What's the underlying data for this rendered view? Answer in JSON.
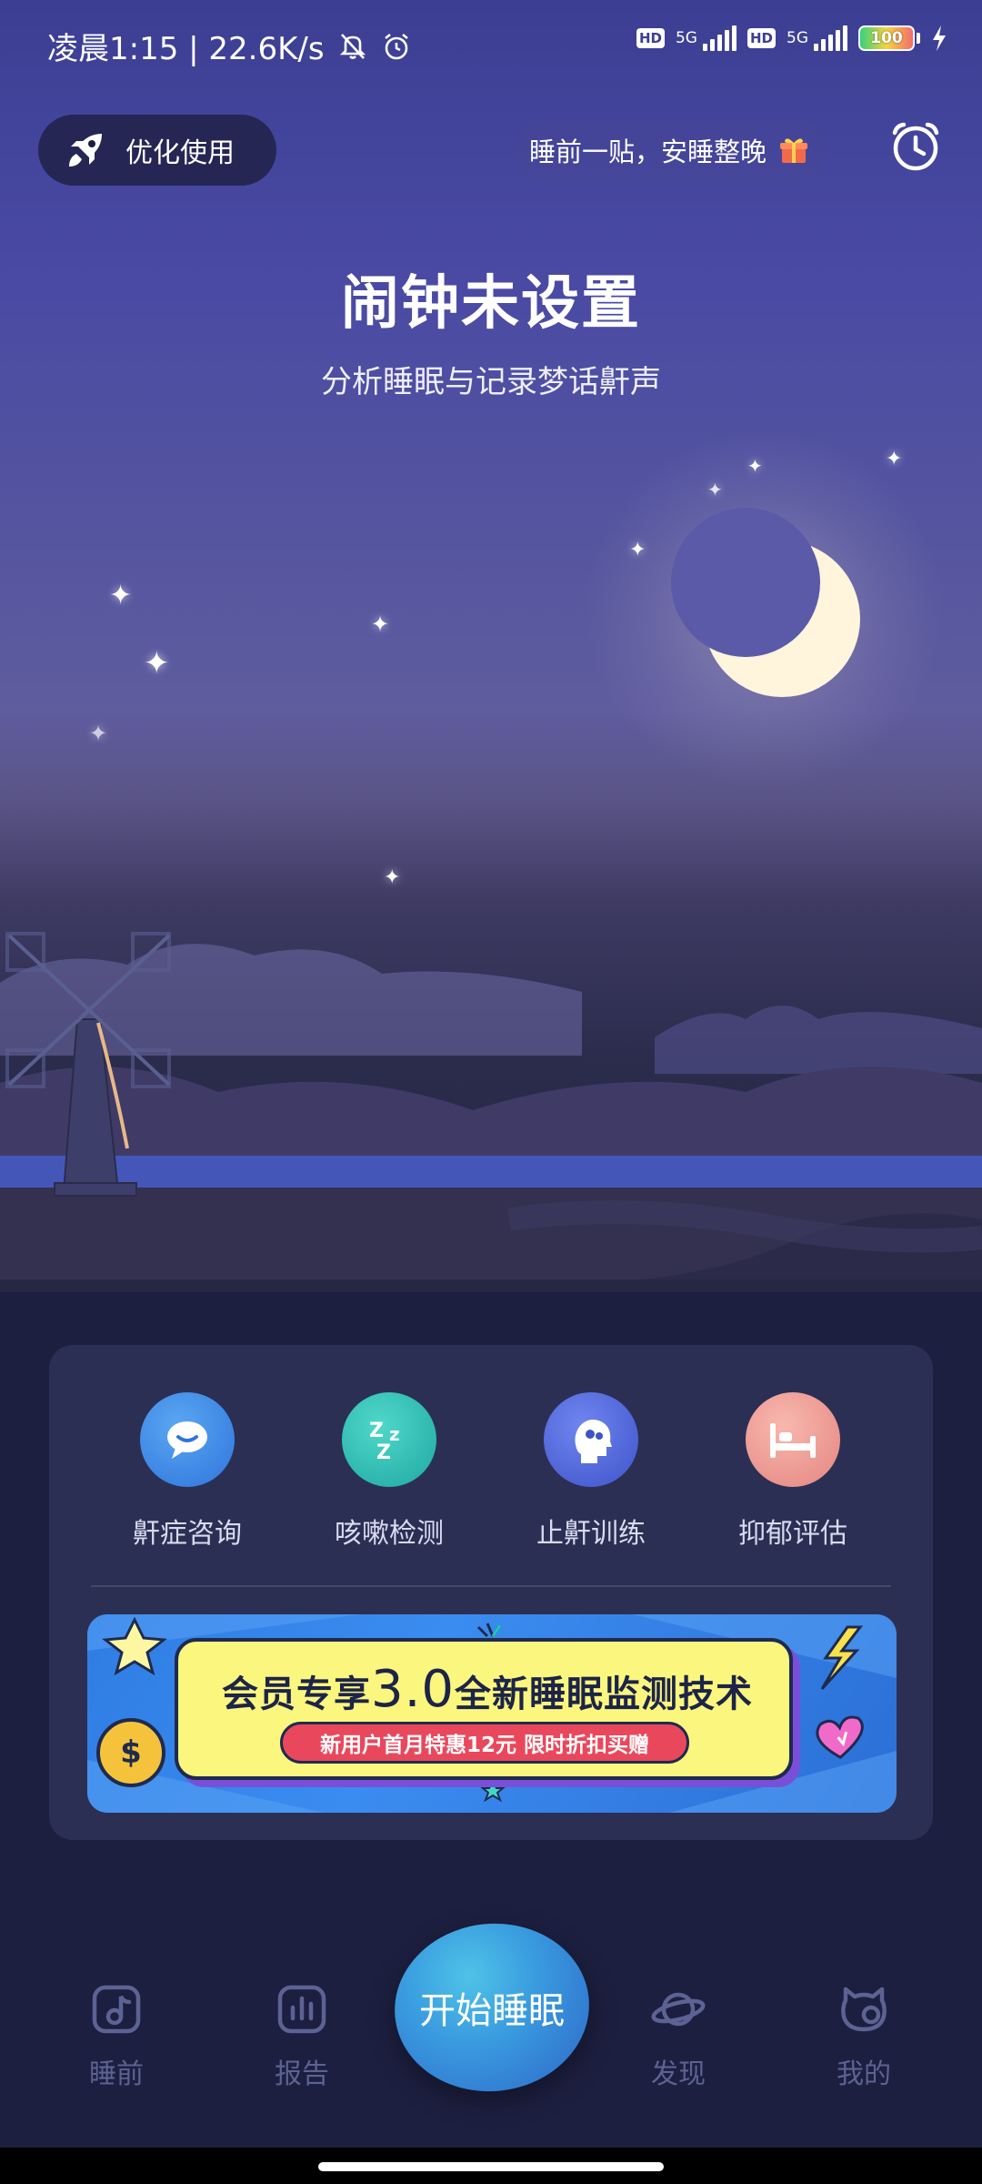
{
  "status_bar": {
    "time_and_speed": "凌晨1:15 | 22.6K/s",
    "hd_label": "HD",
    "network_label": "5G",
    "battery_level": "100",
    "battery_percent": 100,
    "icons": [
      "mute-icon",
      "alarm-status-icon",
      "hd-badge",
      "signal-icon",
      "battery-icon",
      "charging-icon"
    ]
  },
  "header": {
    "optimize_label": "优化使用",
    "promo_label": "睡前一贴，安睡整晚",
    "icons": [
      "rocket-icon",
      "gift-icon",
      "alarm-clock-icon"
    ]
  },
  "hero": {
    "title": "闹钟未设置",
    "subtitle": "分析睡眠与记录梦话鼾声"
  },
  "features": [
    {
      "label": "鼾症咨询",
      "icon": "chat-icon",
      "color": "#3c86e8"
    },
    {
      "label": "咳嗽检测",
      "icon": "zzz-icon",
      "color": "#2fc1b5"
    },
    {
      "label": "止鼾训练",
      "icon": "brain-head-icon",
      "color": "#4a67d9"
    },
    {
      "label": "抑郁评估",
      "icon": "bed-icon",
      "color": "#ee9f9c"
    }
  ],
  "banner": {
    "headline_pre": "会员专享",
    "headline_version": "3.0",
    "headline_post": "全新睡眠监测技术",
    "pill_text": "新用户首月特惠12元   限时折扣买赠",
    "coin_symbol": "$"
  },
  "bottom_nav": {
    "items": [
      {
        "label": "睡前",
        "icon": "music-note-icon"
      },
      {
        "label": "报告",
        "icon": "bar-chart-icon"
      },
      {
        "label": "发现",
        "icon": "planet-icon"
      },
      {
        "label": "我的",
        "icon": "profile-icon"
      }
    ],
    "start_label": "开始睡眠"
  },
  "colors": {
    "sky_top": "#3c3e93",
    "card_bg": "#30345a",
    "nav_inactive": "#5c6293",
    "banner_blue": "#2f7de3",
    "banner_yellow": "#fbf67e",
    "pill_red": "#e9485c"
  }
}
